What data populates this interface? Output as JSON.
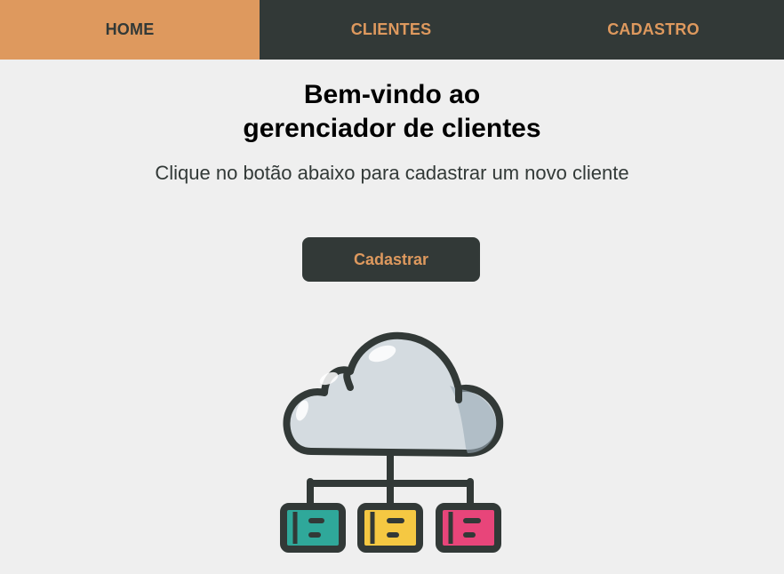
{
  "nav": {
    "items": [
      {
        "label": "HOME",
        "active": true
      },
      {
        "label": "CLIENTES",
        "active": false
      },
      {
        "label": "CADASTRO",
        "active": false
      }
    ]
  },
  "main": {
    "title_line1": "Bem-vindo ao",
    "title_line2": "gerenciador de clientes",
    "subtitle": "Clique no botão abaixo para cadastrar um novo cliente",
    "cta_label": "Cadastrar"
  },
  "illustration": {
    "icon": "cloud-network-icon",
    "node_colors": [
      "#2fa89a",
      "#f5c842",
      "#e8457a"
    ]
  },
  "colors": {
    "accent": "#de995e",
    "dark": "#323937",
    "background": "#efefef"
  }
}
